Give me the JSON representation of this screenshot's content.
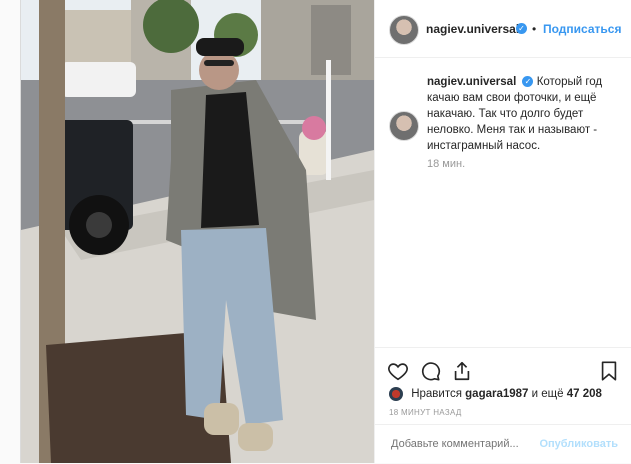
{
  "author": {
    "username": "nagiev.universal",
    "follow_label": "Подписаться",
    "separator": "•"
  },
  "caption": {
    "username": "nagiev.universal",
    "text": "Который год качаю вам свои фоточки, и ещё накачаю. Так что долго будет неловко. Меня так и называют - инстаграмный насос.",
    "time": "18 мин."
  },
  "likes": {
    "prefix": "Нравится",
    "user": "gagara1987",
    "middle": "и ещё",
    "count": "47 208"
  },
  "posted_ago": "18 МИНУТ НАЗАД",
  "comment": {
    "placeholder": "Добавьте комментарий...",
    "publish_label": "Опубликовать"
  },
  "icons": {
    "like": "heart-icon",
    "comment": "comment-icon",
    "share": "share-icon",
    "save": "bookmark-icon",
    "verified": "verified-badge-icon"
  },
  "colors": {
    "accent": "#3897f0",
    "muted": "#999999",
    "border": "#efefef",
    "publish_disabled": "#b2dffc"
  }
}
